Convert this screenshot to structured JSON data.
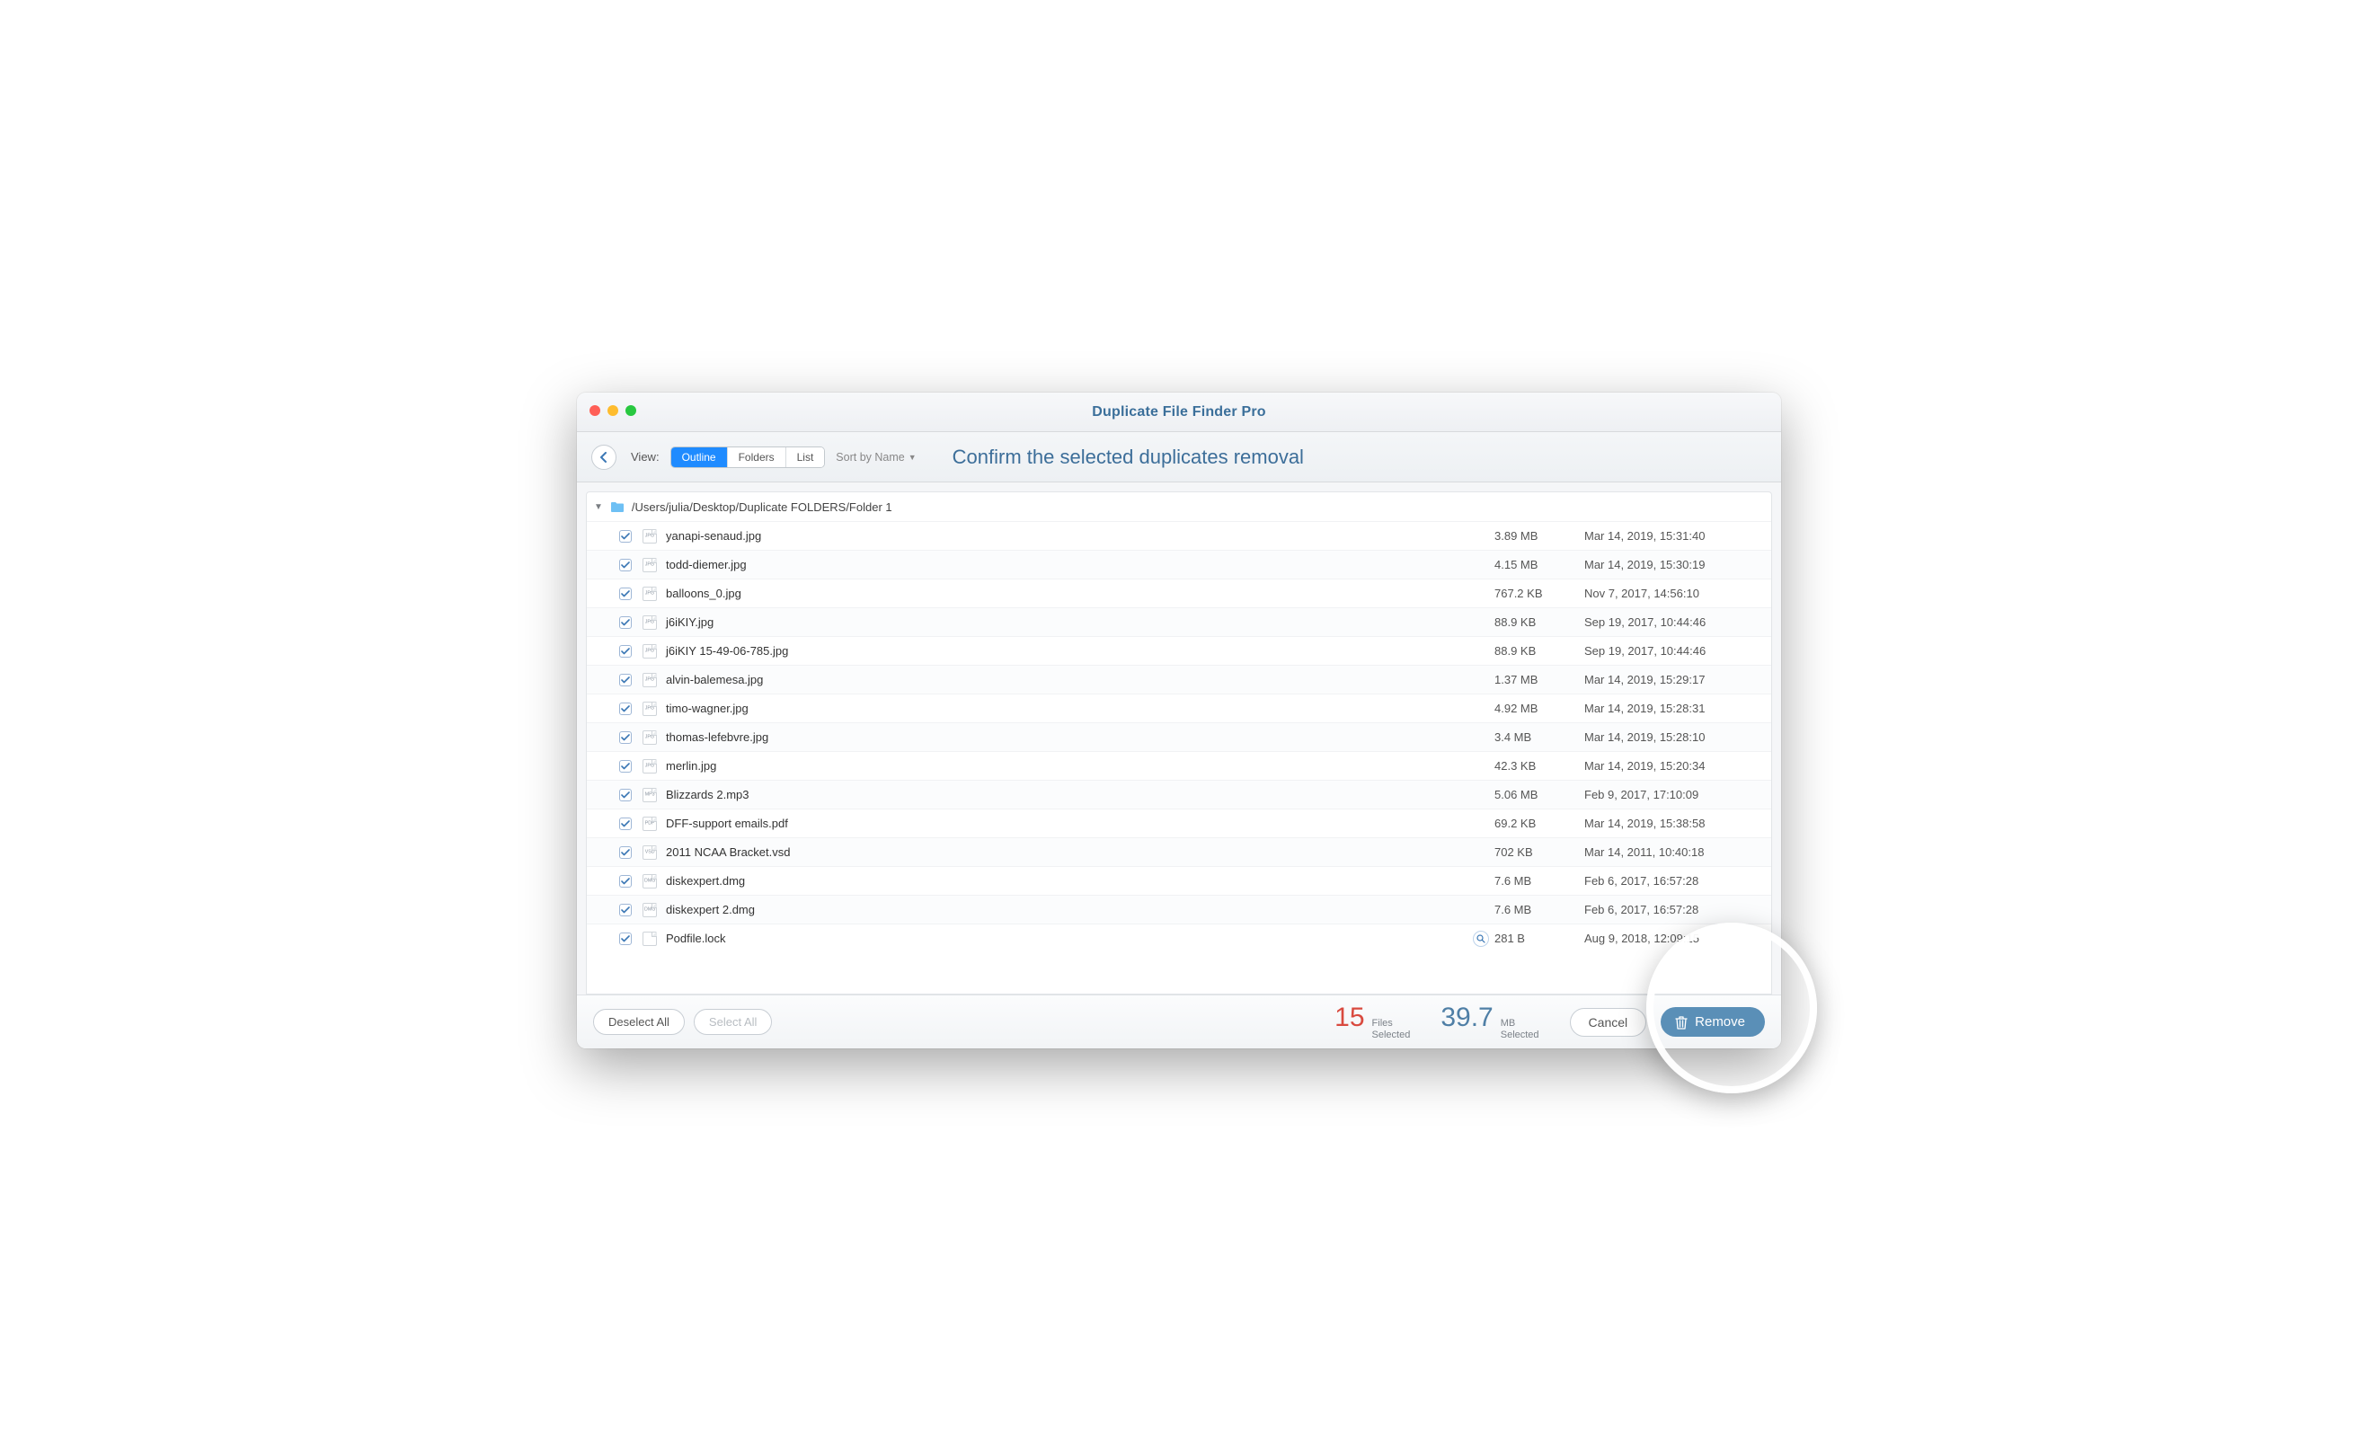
{
  "window": {
    "title": "Duplicate File Finder Pro"
  },
  "toolbar": {
    "view_label": "View:",
    "tabs": {
      "outline": "Outline",
      "folders": "Folders",
      "list": "List"
    },
    "sort_label": "Sort by Name",
    "headline": "Confirm the selected duplicates removal"
  },
  "folder": {
    "path": "/Users/julia/Desktop/Duplicate FOLDERS/Folder 1"
  },
  "files": [
    {
      "name": "yanapi-senaud.jpg",
      "size": "3.89 MB",
      "date": "Mar 14, 2019, 15:31:40",
      "kind": "jpg"
    },
    {
      "name": "todd-diemer.jpg",
      "size": "4.15 MB",
      "date": "Mar 14, 2019, 15:30:19",
      "kind": "jpg"
    },
    {
      "name": "balloons_0.jpg",
      "size": "767.2 KB",
      "date": "Nov 7, 2017, 14:56:10",
      "kind": "jpg"
    },
    {
      "name": "j6iKIY.jpg",
      "size": "88.9 KB",
      "date": "Sep 19, 2017, 10:44:46",
      "kind": "jpg"
    },
    {
      "name": "j6iKIY 15-49-06-785.jpg",
      "size": "88.9 KB",
      "date": "Sep 19, 2017, 10:44:46",
      "kind": "jpg"
    },
    {
      "name": "alvin-balemesa.jpg",
      "size": "1.37 MB",
      "date": "Mar 14, 2019, 15:29:17",
      "kind": "jpg"
    },
    {
      "name": "timo-wagner.jpg",
      "size": "4.92 MB",
      "date": "Mar 14, 2019, 15:28:31",
      "kind": "jpg"
    },
    {
      "name": "thomas-lefebvre.jpg",
      "size": "3.4 MB",
      "date": "Mar 14, 2019, 15:28:10",
      "kind": "jpg"
    },
    {
      "name": "merlin.jpg",
      "size": "42.3 KB",
      "date": "Mar 14, 2019, 15:20:34",
      "kind": "jpg"
    },
    {
      "name": "Blizzards 2.mp3",
      "size": "5.06 MB",
      "date": "Feb 9, 2017, 17:10:09",
      "kind": "mp3"
    },
    {
      "name": "DFF-support emails.pdf",
      "size": "69.2 KB",
      "date": "Mar 14, 2019, 15:38:58",
      "kind": "pdf"
    },
    {
      "name": "2011 NCAA Bracket.vsd",
      "size": "702 KB",
      "date": "Mar 14, 2011, 10:40:18",
      "kind": "vsd"
    },
    {
      "name": "diskexpert.dmg",
      "size": "7.6 MB",
      "date": "Feb 6, 2017, 16:57:28",
      "kind": "dmg"
    },
    {
      "name": "diskexpert 2.dmg",
      "size": "7.6 MB",
      "date": "Feb 6, 2017, 16:57:28",
      "kind": "dmg"
    },
    {
      "name": "Podfile.lock",
      "size": "281 B",
      "date": "Aug 9, 2018, 12:09:15",
      "kind": "gen",
      "quicklook": true
    }
  ],
  "footer": {
    "deselect_all": "Deselect All",
    "select_all": "Select All",
    "files_count": "15",
    "files_label_1": "Files",
    "files_label_2": "Selected",
    "size_value": "39.7",
    "size_label_1": "MB",
    "size_label_2": "Selected",
    "cancel": "Cancel",
    "remove": "Remove"
  }
}
